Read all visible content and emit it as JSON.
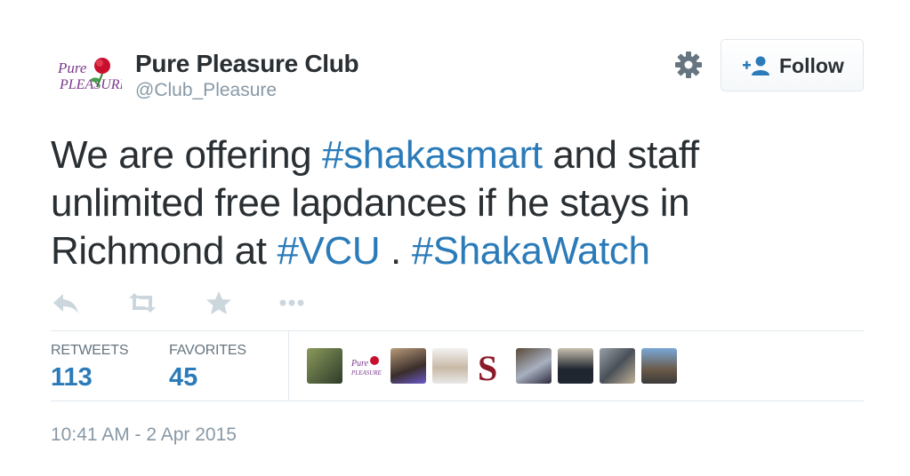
{
  "user": {
    "name": "Pure Pleasure Club",
    "handle": "@Club_Pleasure",
    "avatar_icon": "pure-pleasure-rose-logo",
    "follow_label": "Follow"
  },
  "tweet": {
    "part1": "We are offering ",
    "tag1": "#shakasmart",
    "part2": " and staff unlimited free lapdances if he stays in Richmond at ",
    "tag2": "#VCU",
    "part3": " . ",
    "tag3": "#ShakaWatch"
  },
  "actions": [
    "reply-icon",
    "retweet-icon",
    "favorite-icon",
    "more-icon"
  ],
  "stats": {
    "retweets_label": "RETWEETS",
    "retweets_value": "113",
    "favorites_label": "FAVORITES",
    "favorites_value": "45"
  },
  "timestamp": "10:41 AM - 2 Apr 2015",
  "colors": {
    "link": "#2b7bb9",
    "text": "#292f33",
    "muted": "#8899a6",
    "border": "#e1e8ed"
  }
}
